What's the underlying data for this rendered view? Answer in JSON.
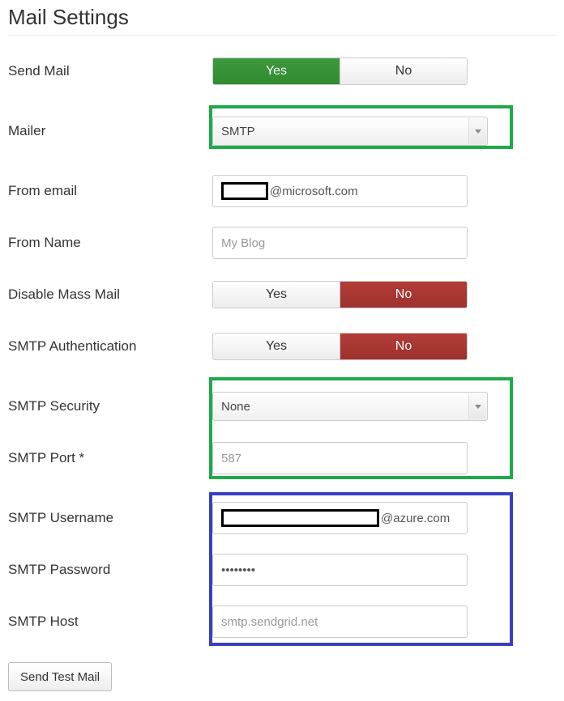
{
  "title": "Mail Settings",
  "labels": {
    "send_mail": "Send Mail",
    "mailer": "Mailer",
    "from_email": "From email",
    "from_name": "From Name",
    "disable_mass": "Disable Mass Mail",
    "smtp_auth": "SMTP Authentication",
    "smtp_security": "SMTP Security",
    "smtp_port": "SMTP Port *",
    "smtp_username": "SMTP Username",
    "smtp_password": "SMTP Password",
    "smtp_host": "SMTP Host"
  },
  "toggles": {
    "yes": "Yes",
    "no": "No"
  },
  "values": {
    "send_mail": "Yes",
    "mailer": "SMTP",
    "from_email_suffix": "@microsoft.com",
    "from_name": "My Blog",
    "disable_mass": "No",
    "smtp_auth": "No",
    "smtp_security": "None",
    "smtp_port": "587",
    "smtp_username_suffix": "@azure.com",
    "smtp_password_masked": "••••••••",
    "smtp_host": "smtp.sendgrid.net"
  },
  "colors": {
    "toggle_green": "#378f37",
    "toggle_red": "#a7352f",
    "highlight_green": "#1fa94a",
    "highlight_blue": "#3b3fbf"
  },
  "button": {
    "send_test": "Send Test Mail"
  }
}
